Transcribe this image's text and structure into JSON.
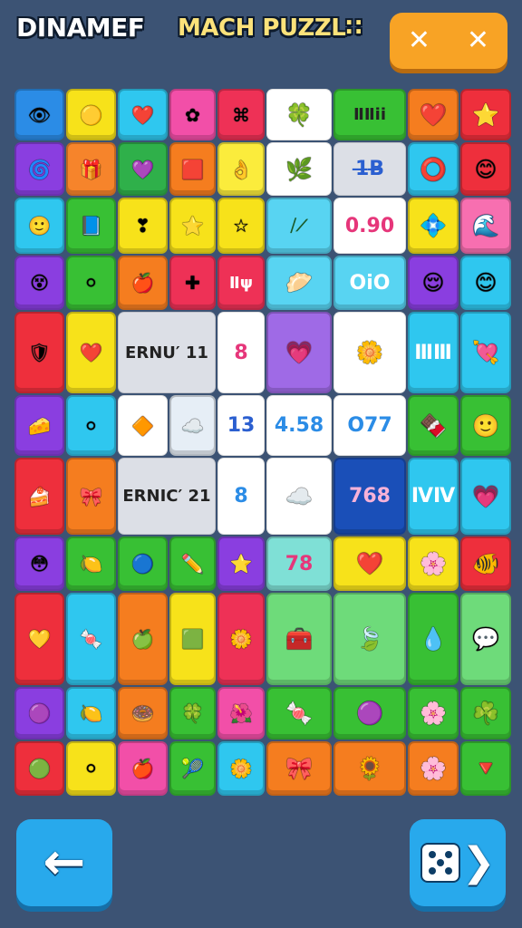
{
  "header": {
    "title_main": "DINAMEF",
    "title_sub": "MACH PUZZL∷",
    "close_icon_left": "✕",
    "close_icon_right": "✕"
  },
  "colors": {
    "background": "#3c5374",
    "accent_orange": "#f8a325",
    "button_blue": "#28a9ec"
  },
  "board": {
    "tiles": [
      {
        "name": "tile-r0c0",
        "bg": "#2b8ce6",
        "icon": "eye-icon",
        "glyph": "👁"
      },
      {
        "name": "tile-r0c1",
        "bg": "#f7e21a",
        "icon": "circle-icon",
        "glyph": "🟡"
      },
      {
        "name": "tile-r0c2",
        "bg": "#2fc7ef",
        "icon": "heart-icon",
        "glyph": "❤️"
      },
      {
        "name": "tile-r0c3",
        "bg": "#f24fa8",
        "icon": "flower-icon",
        "glyph": "✿"
      },
      {
        "name": "tile-r0c4",
        "bg": "#ee3156",
        "icon": "puzzle-icon",
        "glyph": "⌘"
      },
      {
        "name": "tile-r0c5",
        "bg": "#ffffff",
        "icon": "mushroom-icon",
        "glyph": "🍀"
      },
      {
        "name": "tile-r0c6",
        "bg": "#38c034",
        "text": "ⅡⅡⅰⅰ"
      },
      {
        "name": "tile-r0c7",
        "bg": "#f57d1f",
        "icon": "heart-icon",
        "glyph": "❤️"
      },
      {
        "name": "tile-r0c8",
        "bg": "#ee2f3c",
        "icon": "star-icon",
        "glyph": "⭐"
      },
      {
        "name": "tile-r1c0",
        "bg": "#8a3ee0",
        "icon": "swirl-icon",
        "glyph": "🌀"
      },
      {
        "name": "tile-r1c1",
        "bg": "#f6842b",
        "icon": "gift-icon",
        "glyph": "🎁"
      },
      {
        "name": "tile-r1c2",
        "bg": "#2fb04a",
        "icon": "heart-icon",
        "glyph": "💜"
      },
      {
        "name": "tile-r1c3",
        "bg": "#f57d1f",
        "icon": "square-icon",
        "glyph": "🟥"
      },
      {
        "name": "tile-r1c4",
        "bg": "#fbec3c",
        "icon": "hand-icon",
        "glyph": "👌"
      },
      {
        "name": "tile-r1c5",
        "bg": "#ffffff",
        "icon": "leaf-icon",
        "glyph": "🌿"
      },
      {
        "name": "tile-r1c6",
        "bg": "#dcdfe6",
        "text": "1̶B̶",
        "big": true,
        "color": "#2b5fd0"
      },
      {
        "name": "tile-r1c7",
        "bg": "#2fc7ef",
        "icon": "ring-icon",
        "glyph": "⭕"
      },
      {
        "name": "tile-r1c8",
        "bg": "#ee2f3c",
        "icon": "smile-icon",
        "glyph": "😊"
      },
      {
        "name": "tile-r2c0",
        "bg": "#2fc7ef",
        "icon": "smile-icon",
        "glyph": "🙂"
      },
      {
        "name": "tile-r2c1",
        "bg": "#38c034",
        "icon": "book-icon",
        "glyph": "📘"
      },
      {
        "name": "tile-r2c2",
        "bg": "#f7e21a",
        "icon": "heart-icon",
        "glyph": "❣"
      },
      {
        "name": "tile-r2c3",
        "bg": "#f7e21a",
        "icon": "star-icon",
        "glyph": "⭐"
      },
      {
        "name": "tile-r2c4",
        "bg": "#f7e21a",
        "icon": "star-icon",
        "glyph": "☆"
      },
      {
        "name": "tile-r2c5",
        "bg": "#58d4f2",
        "text": "⧸⟋",
        "color": "#1a5a2a"
      },
      {
        "name": "tile-r2c6",
        "bg": "#ffffff",
        "text": "0.90",
        "big": true,
        "color": "#e6367a"
      },
      {
        "name": "tile-r2c7",
        "bg": "#f7e21a",
        "icon": "cloud-icon",
        "glyph": "💠"
      },
      {
        "name": "tile-r2c8",
        "bg": "#f76fb0",
        "icon": "wave-icon",
        "glyph": "🌊"
      },
      {
        "name": "tile-r3c0",
        "bg": "#8a3ee0",
        "icon": "face-icon",
        "glyph": "😵"
      },
      {
        "name": "tile-r3c1",
        "bg": "#38c034",
        "icon": "circle-icon",
        "glyph": "⚪"
      },
      {
        "name": "tile-r3c2",
        "bg": "#f57d1f",
        "icon": "apple-icon",
        "glyph": "🍎"
      },
      {
        "name": "tile-r3c3",
        "bg": "#ee3156",
        "icon": "cross-icon",
        "glyph": "✚"
      },
      {
        "name": "tile-r3c4",
        "bg": "#ee3156",
        "text": "Ⅱψ",
        "color": "#ffffff"
      },
      {
        "name": "tile-r3c5",
        "bg": "#58d4f2",
        "icon": "bun-icon",
        "glyph": "🥟"
      },
      {
        "name": "tile-r3c6",
        "bg": "#58d4f2",
        "text": "OⅰO",
        "big": true,
        "color": "#ffffff"
      },
      {
        "name": "tile-r3c7",
        "bg": "#8a3ee0",
        "icon": "face-icon",
        "glyph": "😌"
      },
      {
        "name": "tile-r3c8",
        "bg": "#2fc7ef",
        "icon": "smile-icon",
        "glyph": "😊"
      },
      {
        "name": "tile-r4c0",
        "bg": "#ee2f3c",
        "icon": "shield-icon",
        "glyph": "🛡"
      },
      {
        "name": "tile-r4c1",
        "bg": "#f7e21a",
        "icon": "hearts-icon",
        "glyph": "❤️"
      },
      {
        "name": "tile-r4c2",
        "bg": "#dcdfe6",
        "text": "ERNU′  11",
        "color": "#222222",
        "wide": true
      },
      {
        "name": "tile-r4c4",
        "bg": "#ffffff",
        "text": "8",
        "big": true,
        "color": "#e6367a"
      },
      {
        "name": "tile-r4c5",
        "bg": "#9f6ae6",
        "icon": "heart-icon",
        "glyph": "💗"
      },
      {
        "name": "tile-r4c6",
        "bg": "#ffffff",
        "icon": "flower-icon",
        "glyph": "🌼"
      },
      {
        "name": "tile-r4c7",
        "bg": "#2fc7ef",
        "text": "ⅢⅢ",
        "big": true,
        "color": "#ffffff"
      },
      {
        "name": "tile-r4c8",
        "bg": "#2fc7ef",
        "icon": "heart-icon",
        "glyph": "💘"
      },
      {
        "name": "tile-r5c0",
        "bg": "#8a3ee0",
        "icon": "cheese-icon",
        "glyph": "🧀"
      },
      {
        "name": "tile-r5c1",
        "bg": "#2fc7ef",
        "icon": "circle-icon",
        "glyph": "⚪"
      },
      {
        "name": "tile-r5c2",
        "bg": "#ffffff",
        "icon": "gem-icon",
        "glyph": "🔶"
      },
      {
        "name": "tile-r5c3",
        "bg": "#e6eef6",
        "icon": "cloud-icon",
        "glyph": "☁️"
      },
      {
        "name": "tile-r5c4",
        "bg": "#ffffff",
        "text": "13",
        "big": true,
        "color": "#2b5fd0"
      },
      {
        "name": "tile-r5c5",
        "bg": "#ffffff",
        "text": "4.58",
        "big": true,
        "color": "#2b8ce6"
      },
      {
        "name": "tile-r5c6",
        "bg": "#ffffff",
        "text": "O77",
        "big": true,
        "color": "#2b8ce6"
      },
      {
        "name": "tile-r5c7",
        "bg": "#38c034",
        "icon": "bolt-icon",
        "glyph": "🍫"
      },
      {
        "name": "tile-r5c8",
        "bg": "#38c034",
        "icon": "smile-icon",
        "glyph": "🙂"
      },
      {
        "name": "tile-r6c0",
        "bg": "#ee2f3c",
        "icon": "cake-icon",
        "glyph": "🍰"
      },
      {
        "name": "tile-r6c1",
        "bg": "#f57d1f",
        "icon": "bow-icon",
        "glyph": "🎀"
      },
      {
        "name": "tile-r6c2",
        "bg": "#dcdfe6",
        "text": "ERNIC′  21",
        "color": "#222222",
        "wide": true
      },
      {
        "name": "tile-r6c4",
        "bg": "#ffffff",
        "text": "8",
        "big": true,
        "color": "#2b8ce6"
      },
      {
        "name": "tile-r6c5",
        "bg": "#ffffff",
        "icon": "cloud-icon",
        "glyph": "☁️"
      },
      {
        "name": "tile-r6c6",
        "bg": "#1a4fb8",
        "text": "768",
        "big": true,
        "color": "#f7b2d8"
      },
      {
        "name": "tile-r6c7",
        "bg": "#2fc7ef",
        "text": "ⅣⅣ",
        "big": true,
        "color": "#ffffff"
      },
      {
        "name": "tile-r6c8",
        "bg": "#2fc7ef",
        "icon": "heart-icon",
        "glyph": "💗"
      },
      {
        "name": "tile-r7c0",
        "bg": "#8a3ee0",
        "icon": "face-icon",
        "glyph": "😳"
      },
      {
        "name": "tile-r7c1",
        "bg": "#38c034",
        "icon": "apple-icon",
        "glyph": "🍋"
      },
      {
        "name": "tile-r7c2",
        "bg": "#38c034",
        "icon": "circle-icon",
        "glyph": "🔵"
      },
      {
        "name": "tile-r7c3",
        "bg": "#38c034",
        "icon": "pencil-icon",
        "glyph": "✏️"
      },
      {
        "name": "tile-r7c4",
        "bg": "#8a3ee0",
        "icon": "star-icon",
        "glyph": "⭐"
      },
      {
        "name": "tile-r7c5",
        "bg": "#7fe0d6",
        "text": "78",
        "big": true,
        "color": "#e6367a"
      },
      {
        "name": "tile-r7c6",
        "bg": "#f7e21a",
        "icon": "heart-icon",
        "glyph": "❤️"
      },
      {
        "name": "tile-r7c7",
        "bg": "#f7e21a",
        "icon": "flower-icon",
        "glyph": "🌸"
      },
      {
        "name": "tile-r7c8",
        "bg": "#ee2f3c",
        "icon": "fish-icon",
        "glyph": "🐠"
      },
      {
        "name": "tile-r8c0",
        "bg": "#ee2f3c",
        "icon": "heart-icon",
        "glyph": "💛"
      },
      {
        "name": "tile-r8c1",
        "bg": "#2fc7ef",
        "icon": "candy-icon",
        "glyph": "🍬"
      },
      {
        "name": "tile-r8c2",
        "bg": "#f57d1f",
        "icon": "apple-icon",
        "glyph": "🍏"
      },
      {
        "name": "tile-r8c3",
        "bg": "#f7e21a",
        "icon": "square-icon",
        "glyph": "🟩"
      },
      {
        "name": "tile-r8c4",
        "bg": "#ee3156",
        "icon": "flower-icon",
        "glyph": "🌼"
      },
      {
        "name": "tile-r8c5",
        "bg": "#6edb7a",
        "icon": "box-icon",
        "glyph": "🧰"
      },
      {
        "name": "tile-r8c6",
        "bg": "#6edb7a",
        "icon": "leaf-icon",
        "glyph": "🍃"
      },
      {
        "name": "tile-r8c7",
        "bg": "#38c034",
        "icon": "blob-icon",
        "glyph": "💧"
      },
      {
        "name": "tile-r8c8",
        "bg": "#6edb7a",
        "icon": "bubble-icon",
        "glyph": "💬"
      },
      {
        "name": "tile-r9c0",
        "bg": "#8a3ee0",
        "icon": "ring-icon",
        "glyph": "🟣"
      },
      {
        "name": "tile-r9c1",
        "bg": "#2fc7ef",
        "icon": "lemon-icon",
        "glyph": "🍋"
      },
      {
        "name": "tile-r9c2",
        "bg": "#f57d1f",
        "icon": "donut-icon",
        "glyph": "🍩"
      },
      {
        "name": "tile-r9c3",
        "bg": "#38c034",
        "icon": "flower-icon",
        "glyph": "🍀"
      },
      {
        "name": "tile-r9c4",
        "bg": "#f24fa8",
        "icon": "flower-icon",
        "glyph": "🌺"
      },
      {
        "name": "tile-r9c5",
        "bg": "#38c034",
        "icon": "candy-icon",
        "glyph": "🍬"
      },
      {
        "name": "tile-r9c6",
        "bg": "#38c034",
        "icon": "blob-icon",
        "glyph": "🟣"
      },
      {
        "name": "tile-r9c7",
        "bg": "#38c034",
        "icon": "flower-icon",
        "glyph": "🌸"
      },
      {
        "name": "tile-r9c8",
        "bg": "#38c034",
        "icon": "cloud-icon",
        "glyph": "☘️"
      },
      {
        "name": "tile-r10c0",
        "bg": "#ee2f3c",
        "icon": "ring-icon",
        "glyph": "🟢"
      },
      {
        "name": "tile-r10c1",
        "bg": "#f7e21a",
        "icon": "ring-icon",
        "glyph": "⚪"
      },
      {
        "name": "tile-r10c2",
        "bg": "#f24fa8",
        "icon": "apple-icon",
        "glyph": "🍎"
      },
      {
        "name": "tile-r10c3",
        "bg": "#38c034",
        "icon": "ball-icon",
        "glyph": "🎾"
      },
      {
        "name": "tile-r10c4",
        "bg": "#2fc7ef",
        "icon": "flower-icon",
        "glyph": "🌼"
      },
      {
        "name": "tile-r10c5",
        "bg": "#f57d1f",
        "icon": "bow-icon",
        "glyph": "🎀"
      },
      {
        "name": "tile-r10c6",
        "bg": "#f57d1f",
        "icon": "flower-icon",
        "glyph": "🌻"
      },
      {
        "name": "tile-r10c7",
        "bg": "#f57d1f",
        "icon": "flower-icon",
        "glyph": "🌸"
      },
      {
        "name": "tile-r10c8",
        "bg": "#38c034",
        "icon": "shape-icon",
        "glyph": "🔻"
      }
    ]
  },
  "footer": {
    "back_icon": "←",
    "next_icon": "❯"
  }
}
